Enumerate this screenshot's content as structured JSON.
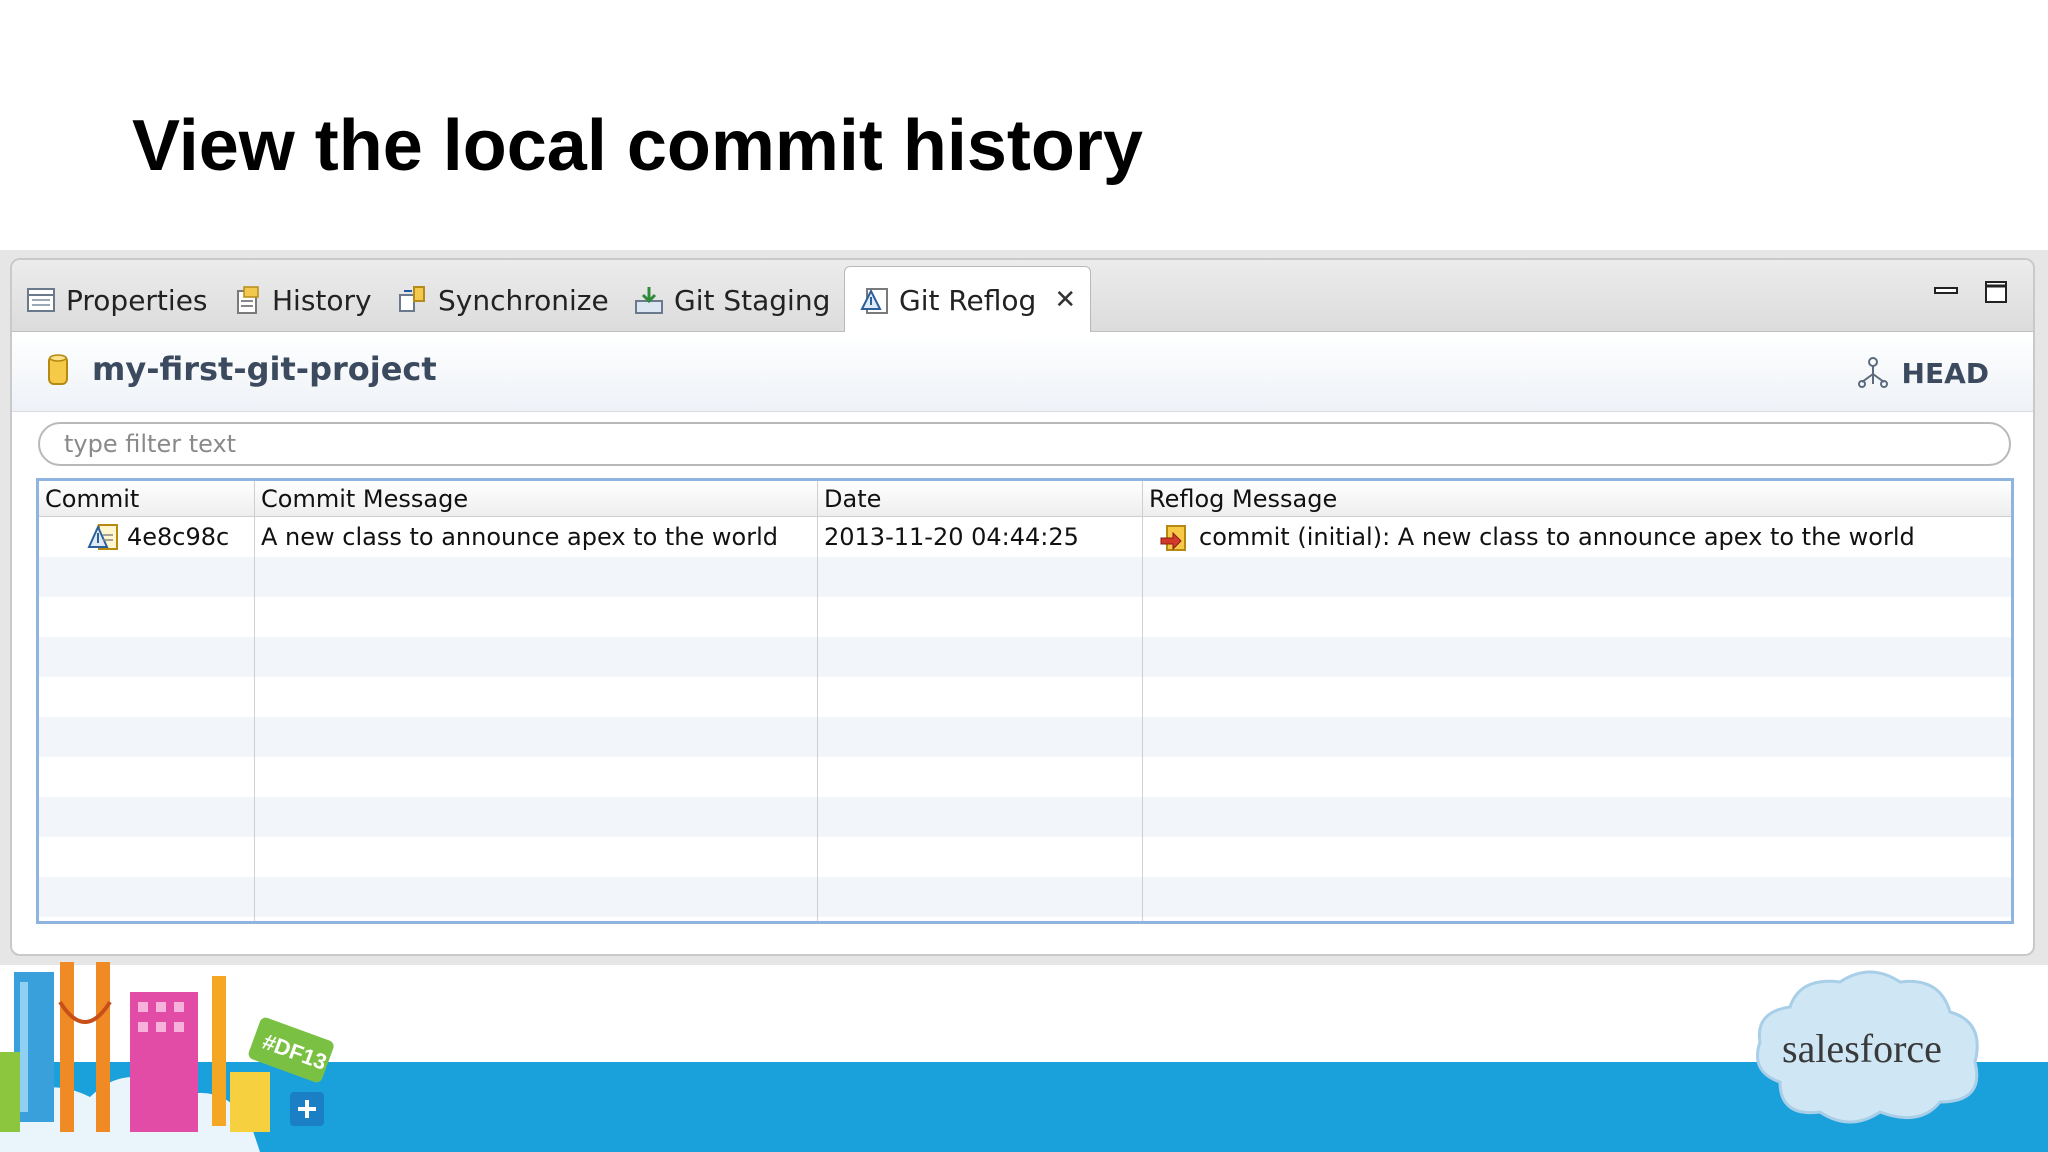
{
  "slide": {
    "title": "View the local commit history"
  },
  "tabs": [
    {
      "label": "Properties",
      "icon": "properties-icon"
    },
    {
      "label": "History",
      "icon": "history-icon"
    },
    {
      "label": "Synchronize",
      "icon": "synchronize-icon"
    },
    {
      "label": "Git Staging",
      "icon": "git-staging-icon"
    },
    {
      "label": "Git Reflog",
      "icon": "git-reflog-icon",
      "active": true,
      "close": "✕"
    }
  ],
  "window_controls": {
    "minimize": "minimize-icon",
    "maximize": "maximize-icon"
  },
  "header": {
    "project": "my-first-git-project",
    "ref": "HEAD"
  },
  "filter": {
    "placeholder": "type filter text",
    "value": ""
  },
  "table": {
    "columns": [
      "Commit",
      "Commit Message",
      "Date",
      "Reflog Message"
    ],
    "rows": [
      {
        "commit": "4e8c98c",
        "message": "A new class to announce apex to the world",
        "date": "2013-11-20 04:44:25",
        "reflog": "commit (initial): A new class to announce apex to the world"
      }
    ]
  },
  "branding": {
    "logo_text": "salesforce",
    "badge_text": "#DF13",
    "colors": {
      "band": "#1aa0db",
      "cloud": "#cfe6f5"
    }
  }
}
